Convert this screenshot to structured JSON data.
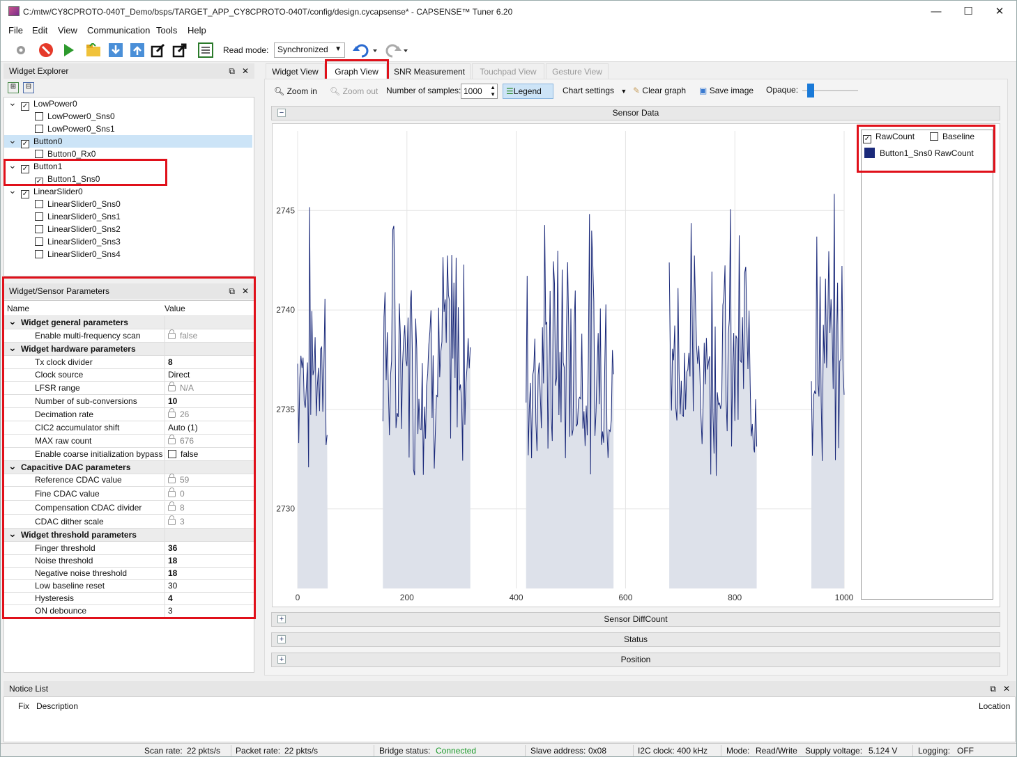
{
  "window": {
    "title": "C:/mtw/CY8CPROTO-040T_Demo/bsps/TARGET_APP_CY8CPROTO-040T/config/design.cycapsense* - CAPSENSE™ Tuner 6.20",
    "minimize": "—",
    "maximize": "☐",
    "close": "✕"
  },
  "menu": [
    "File",
    "Edit",
    "View",
    "Communication",
    "Tools",
    "Help"
  ],
  "toolbar": {
    "read_mode_label": "Read mode:",
    "read_mode_value": "Synchronized"
  },
  "widget_explorer": {
    "title": "Widget Explorer",
    "items": [
      {
        "label": "LowPower0",
        "checked": true,
        "level": 0
      },
      {
        "label": "LowPower0_Sns0",
        "checked": false,
        "level": 1
      },
      {
        "label": "LowPower0_Sns1",
        "checked": false,
        "level": 1
      },
      {
        "label": "Button0",
        "checked": true,
        "level": 0
      },
      {
        "label": "Button0_Rx0",
        "checked": false,
        "level": 1
      },
      {
        "label": "Button1",
        "checked": true,
        "level": 0
      },
      {
        "label": "Button1_Sns0",
        "checked": true,
        "level": 1
      },
      {
        "label": "LinearSlider0",
        "checked": true,
        "level": 0
      },
      {
        "label": "LinearSlider0_Sns0",
        "checked": false,
        "level": 1
      },
      {
        "label": "LinearSlider0_Sns1",
        "checked": false,
        "level": 1
      },
      {
        "label": "LinearSlider0_Sns2",
        "checked": false,
        "level": 1
      },
      {
        "label": "LinearSlider0_Sns3",
        "checked": false,
        "level": 1
      },
      {
        "label": "LinearSlider0_Sns4",
        "checked": false,
        "level": 1
      }
    ]
  },
  "params": {
    "title": "Widget/Sensor Parameters",
    "col_name": "Name",
    "col_value": "Value",
    "rows": [
      {
        "type": "cat",
        "name": "Widget general parameters"
      },
      {
        "name": "Enable multi-frequency scan",
        "value": "false",
        "lock": true,
        "style": "g"
      },
      {
        "type": "cat",
        "name": "Widget hardware parameters"
      },
      {
        "name": "Tx clock divider",
        "value": "8",
        "style": "b"
      },
      {
        "name": "Clock source",
        "value": "Direct"
      },
      {
        "name": "LFSR range",
        "value": "N/A",
        "lock": true,
        "style": "g"
      },
      {
        "name": "Number of sub-conversions",
        "value": "10",
        "style": "b"
      },
      {
        "name": "Decimation rate",
        "value": "26",
        "lock": true,
        "style": "g"
      },
      {
        "name": "CIC2 accumulator shift",
        "value": "Auto (1)"
      },
      {
        "name": "MAX raw count",
        "value": "676",
        "lock": true,
        "style": "g"
      },
      {
        "name": "Enable coarse initialization bypass",
        "value": "false",
        "checkbox": true
      },
      {
        "type": "cat",
        "name": "Capacitive DAC parameters"
      },
      {
        "name": "Reference CDAC value",
        "value": "59",
        "lock": true,
        "style": "g"
      },
      {
        "name": "Fine CDAC value",
        "value": "0",
        "lock": true,
        "style": "g"
      },
      {
        "name": "Compensation CDAC divider",
        "value": "8",
        "lock": true,
        "style": "g"
      },
      {
        "name": "CDAC dither scale",
        "value": "3",
        "lock": true,
        "style": "g"
      },
      {
        "type": "cat",
        "name": "Widget threshold parameters"
      },
      {
        "name": "Finger threshold",
        "value": "36",
        "style": "b"
      },
      {
        "name": "Noise threshold",
        "value": "18",
        "style": "b"
      },
      {
        "name": "Negative noise threshold",
        "value": "18",
        "style": "b"
      },
      {
        "name": "Low baseline reset",
        "value": "30"
      },
      {
        "name": "Hysteresis",
        "value": "4",
        "style": "b"
      },
      {
        "name": "ON debounce",
        "value": "3"
      }
    ]
  },
  "tabs": [
    {
      "label": "Widget View",
      "state": "normal"
    },
    {
      "label": "Graph View",
      "state": "active"
    },
    {
      "label": "SNR Measurement",
      "state": "normal"
    },
    {
      "label": "Touchpad View",
      "state": "disabled"
    },
    {
      "label": "Gesture View",
      "state": "disabled"
    }
  ],
  "graph_toolbar": {
    "zoom_in": "Zoom in",
    "zoom_out": "Zoom out",
    "samples_label": "Number of samples:",
    "samples_value": "1000",
    "legend": "Legend",
    "chart_settings": "Chart settings",
    "clear_graph": "Clear graph",
    "save_image": "Save image",
    "opaque": "Opaque:",
    "opaque_level": 0.1
  },
  "sections": {
    "sensor_data": "Sensor Data",
    "sensor_diffcount": "Sensor DiffCount",
    "status": "Status",
    "position": "Position"
  },
  "legend": {
    "rawcount": "RawCount",
    "rawcount_checked": true,
    "baseline": "Baseline",
    "baseline_checked": false,
    "series_label": "Button1_Sns0 RawCount",
    "series_color": "#1b2a7a"
  },
  "chart_data": {
    "type": "line",
    "xlim": [
      0,
      1000
    ],
    "ylim": [
      2726,
      2749
    ],
    "x_ticks": [
      "0",
      "200",
      "400",
      "600",
      "800",
      "1000"
    ],
    "y_ticks": [
      "2730",
      "2735",
      "2740",
      "2745"
    ],
    "series": [
      {
        "name": "Button1_Sns0 RawCount",
        "color": "#1b2a7a",
        "fill": "#dde1ea"
      }
    ],
    "active_segments": [
      [
        0,
        55
      ],
      [
        156,
        316
      ],
      [
        418,
        578
      ],
      [
        680,
        840
      ],
      [
        940,
        1000
      ]
    ],
    "touch_segments_min": 2726,
    "touch_value_range": [
      2728,
      2748
    ],
    "baseline_value": 2726
  },
  "notice_list": {
    "title": "Notice List",
    "col_fix": "Fix",
    "col_description": "Description",
    "col_location": "Location"
  },
  "statusbar": {
    "scan_rate_label": "Scan rate:",
    "scan_rate": "22 pkts/s",
    "packet_rate_label": "Packet rate:",
    "packet_rate": "22 pkts/s",
    "bridge_label": "Bridge status:",
    "bridge": "Connected",
    "slave_label": "Slave address:",
    "slave": "0x08",
    "i2c_label": "I2C clock:",
    "i2c": "400 kHz",
    "mode_label": "Mode:",
    "mode": "Read/Write",
    "supply_label": "Supply voltage:",
    "supply": "5.124 V",
    "logging_label": "Logging:",
    "logging": "OFF"
  }
}
